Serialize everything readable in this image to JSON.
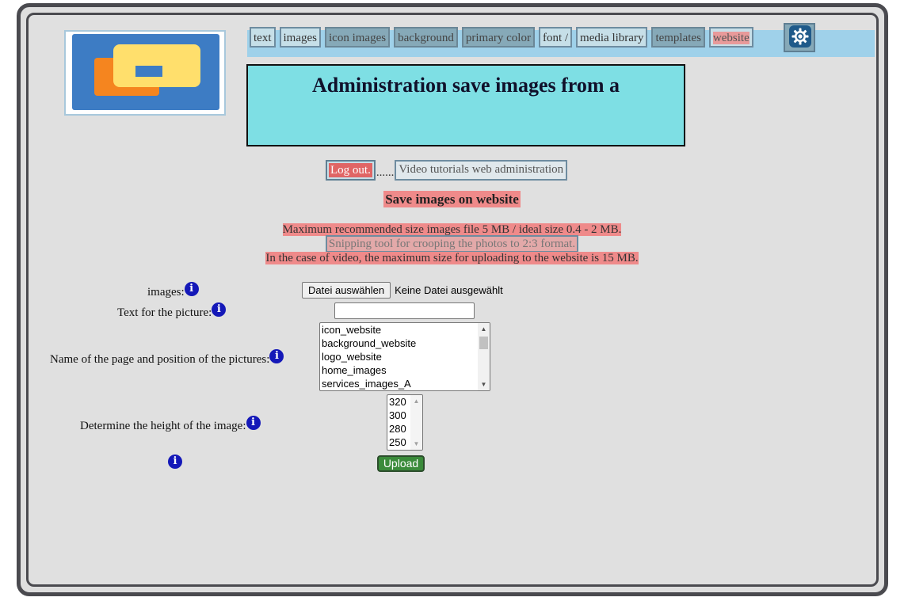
{
  "nav": {
    "items": [
      {
        "label": "text",
        "style": "light"
      },
      {
        "label": "images",
        "style": "light"
      },
      {
        "label": "icon images",
        "style": "dark"
      },
      {
        "label": "background",
        "style": "dark"
      },
      {
        "label": "primary color",
        "style": "dark"
      },
      {
        "label": "font /",
        "style": "light"
      },
      {
        "label": "media library",
        "style": "light"
      },
      {
        "label": "templates",
        "style": "dark"
      },
      {
        "label": "website",
        "style": "site"
      }
    ],
    "settings_icon": "gear-icon"
  },
  "header": {
    "title": "Administration save images from a"
  },
  "links": {
    "logout": "Log out.",
    "separator": "......",
    "video": "Video tutorials web administration"
  },
  "subtitle": "Save images on website",
  "notices": {
    "size": "Maximum recommended size images file 5 MB / ideal size 0.4 - 2 MB.",
    "snipping": "Snipping tool for crooping the photos to 2:3 format.",
    "video": "In the case of video, the maximum size for uploading to the website is 15 MB."
  },
  "form": {
    "images_label": "images:",
    "file_button": "Datei auswählen",
    "file_status": "Keine Datei ausgewählt",
    "text_label": "Text for the picture:",
    "text_value": "",
    "page_label": "Name of the page and position of the pictures:",
    "page_options": [
      "icon_website",
      "background_website",
      "logo_website",
      "home_images",
      "services_images_A"
    ],
    "height_label": "Determine the height of the image:",
    "height_options": [
      "320",
      "300",
      "280",
      "250"
    ],
    "upload_button": "Upload",
    "info_glyph": "i"
  },
  "colors": {
    "title_bg": "#7edfe4",
    "nav_bar": "#9fd1ea",
    "highlight": "#ef8a8a",
    "upload": "#3a8b3a",
    "info": "#1418b8"
  }
}
